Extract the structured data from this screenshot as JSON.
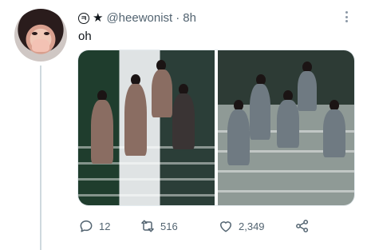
{
  "tweet": {
    "author_badge": "ㅋ",
    "author_star": "★",
    "handle": "@heewonist",
    "separator": "·",
    "time": "8h",
    "text": "oh"
  },
  "actions": {
    "replies": "12",
    "retweets": "516",
    "likes": "2,349"
  },
  "icons": {
    "more": "more-options-icon",
    "reply": "reply-icon",
    "retweet": "retweet-icon",
    "like": "like-icon",
    "share": "share-icon"
  },
  "colors": {
    "text": "#0f1419",
    "secondary": "#536471",
    "thread_line": "#cfd9de"
  }
}
